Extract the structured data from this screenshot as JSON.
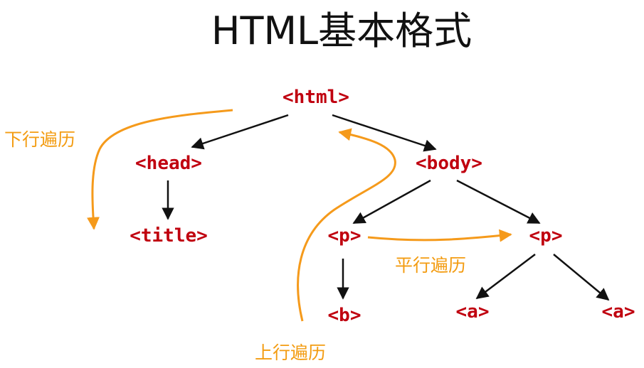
{
  "title": "HTML基本格式",
  "nodes": {
    "html": "<html>",
    "head": "<head>",
    "body": "<body>",
    "title": "<title>",
    "p1": "<p>",
    "p2": "<p>",
    "b": "<b>",
    "a1": "<a>",
    "a2": "<a>"
  },
  "traversals": {
    "down": "下行遍历",
    "up": "上行遍历",
    "parallel": "平行遍历"
  },
  "colors": {
    "node_text": "#c0000f",
    "edge": "#111111",
    "traversal": "#f59a1b",
    "title_text": "#111111"
  }
}
